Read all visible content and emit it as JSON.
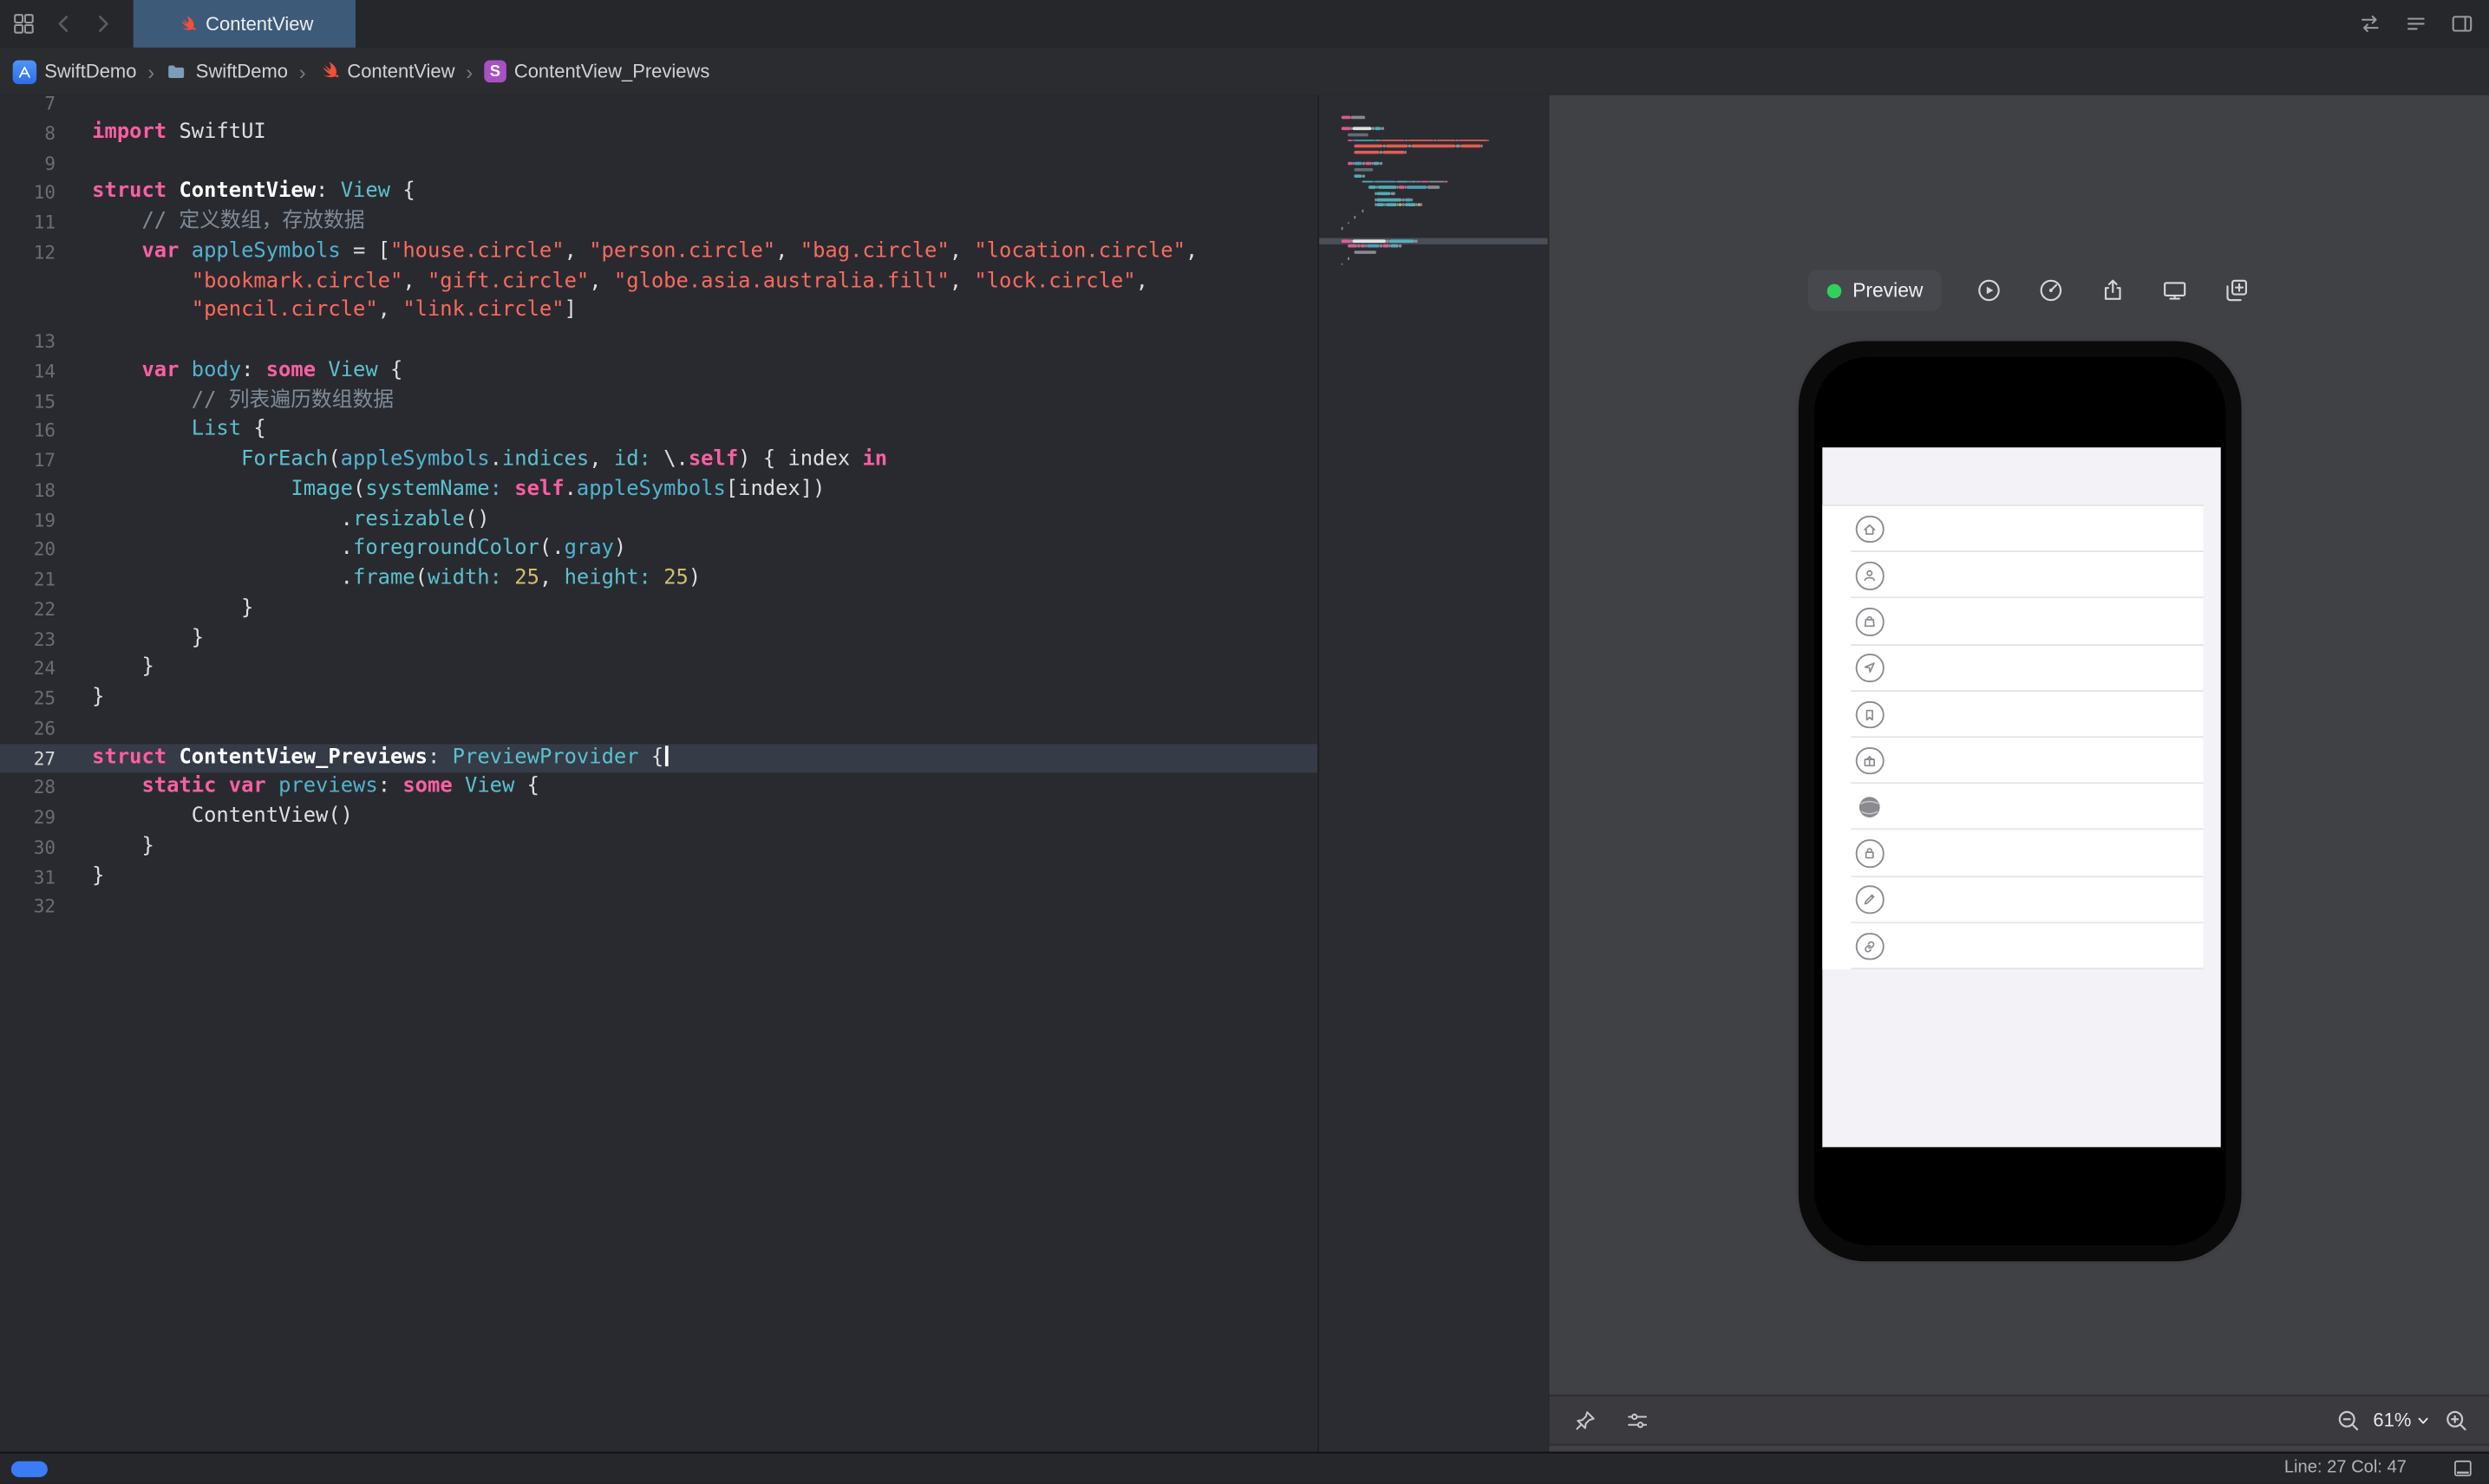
{
  "tabbar": {
    "tab_title": "ContentView",
    "left_icons": [
      "grid-icon",
      "chevron-back-icon",
      "chevron-forward-icon"
    ],
    "right_icons": [
      "code-review-icon",
      "editor-options-icon",
      "inspector-panel-icon"
    ]
  },
  "breadcrumb": {
    "separator": "›",
    "items": [
      {
        "icon": "app-badge-icon",
        "label": "SwiftDemo"
      },
      {
        "icon": "folder-icon",
        "label": "SwiftDemo"
      },
      {
        "icon": "swift-file-icon",
        "label": "ContentView"
      },
      {
        "icon": "struct-badge-icon",
        "label": "ContentView_Previews"
      }
    ]
  },
  "editor": {
    "rows": [
      {
        "n": "7"
      },
      {
        "n": "8",
        "t": [
          [
            "kw",
            "import"
          ],
          [
            "pl",
            " SwiftUI"
          ]
        ]
      },
      {
        "n": "9"
      },
      {
        "n": "10",
        "t": [
          [
            "kw",
            "struct"
          ],
          [
            "pl",
            " "
          ],
          [
            "de",
            "ContentView"
          ],
          [
            "pl",
            ": "
          ],
          [
            "ty",
            "View"
          ],
          [
            "pl",
            " {"
          ]
        ]
      },
      {
        "n": "11",
        "i": 4,
        "t": [
          [
            "cm",
            "// 定义数组，存放数据"
          ]
        ]
      },
      {
        "n": "12",
        "i": 4,
        "t": [
          [
            "kw",
            "var"
          ],
          [
            "pl",
            " "
          ],
          [
            "bl",
            "appleSymbols"
          ],
          [
            "pl",
            " = ["
          ],
          [
            "st",
            "\"house.circle\""
          ],
          [
            "pl",
            ", "
          ],
          [
            "st",
            "\"person.circle\""
          ],
          [
            "pl",
            ", "
          ],
          [
            "st",
            "\"bag.circle\""
          ],
          [
            "pl",
            ", "
          ],
          [
            "st",
            "\"location.circle\""
          ],
          [
            "pl",
            ","
          ]
        ]
      },
      {
        "i": 8,
        "t": [
          [
            "st",
            "\"bookmark.circle\""
          ],
          [
            "pl",
            ", "
          ],
          [
            "st",
            "\"gift.circle\""
          ],
          [
            "pl",
            ", "
          ],
          [
            "st",
            "\"globe.asia.australia.fill\""
          ],
          [
            "pl",
            ", "
          ],
          [
            "st",
            "\"lock.circle\""
          ],
          [
            "pl",
            ","
          ]
        ]
      },
      {
        "i": 8,
        "t": [
          [
            "st",
            "\"pencil.circle\""
          ],
          [
            "pl",
            ", "
          ],
          [
            "st",
            "\"link.circle\""
          ],
          [
            "pl",
            "]"
          ]
        ]
      },
      {
        "n": "13"
      },
      {
        "n": "14",
        "i": 4,
        "t": [
          [
            "kw",
            "var"
          ],
          [
            "pl",
            " "
          ],
          [
            "bl",
            "body"
          ],
          [
            "pl",
            ": "
          ],
          [
            "kw",
            "some"
          ],
          [
            "pl",
            " "
          ],
          [
            "ty",
            "View"
          ],
          [
            "pl",
            " {"
          ]
        ]
      },
      {
        "n": "15",
        "i": 8,
        "t": [
          [
            "cm",
            "// 列表遍历数组数据"
          ]
        ]
      },
      {
        "n": "16",
        "i": 8,
        "t": [
          [
            "ty",
            "List"
          ],
          [
            "pl",
            " {"
          ]
        ]
      },
      {
        "n": "17",
        "i": 12,
        "t": [
          [
            "ty",
            "ForEach"
          ],
          [
            "pl",
            "("
          ],
          [
            "bl",
            "appleSymbols"
          ],
          [
            "pl",
            "."
          ],
          [
            "ty",
            "indices"
          ],
          [
            "pl",
            ", "
          ],
          [
            "ty",
            "id:"
          ],
          [
            "pl",
            " \\."
          ],
          [
            "kw",
            "self"
          ],
          [
            "pl",
            ") { index "
          ],
          [
            "kw",
            "in"
          ]
        ]
      },
      {
        "n": "18",
        "i": 16,
        "t": [
          [
            "ty",
            "Image"
          ],
          [
            "pl",
            "("
          ],
          [
            "ty",
            "systemName:"
          ],
          [
            "pl",
            " "
          ],
          [
            "kw",
            "self"
          ],
          [
            "pl",
            "."
          ],
          [
            "bl",
            "appleSymbols"
          ],
          [
            "pl",
            "[index])"
          ]
        ]
      },
      {
        "n": "19",
        "i": 20,
        "t": [
          [
            "pl",
            "."
          ],
          [
            "ty",
            "resizable"
          ],
          [
            "pl",
            "()"
          ]
        ]
      },
      {
        "n": "20",
        "i": 20,
        "t": [
          [
            "pl",
            "."
          ],
          [
            "ty",
            "foregroundColor"
          ],
          [
            "pl",
            "(."
          ],
          [
            "bl",
            "gray"
          ],
          [
            "pl",
            ")"
          ]
        ]
      },
      {
        "n": "21",
        "i": 20,
        "t": [
          [
            "pl",
            "."
          ],
          [
            "ty",
            "frame"
          ],
          [
            "pl",
            "("
          ],
          [
            "ty",
            "width:"
          ],
          [
            "pl",
            " "
          ],
          [
            "nu",
            "25"
          ],
          [
            "pl",
            ", "
          ],
          [
            "ty",
            "height:"
          ],
          [
            "pl",
            " "
          ],
          [
            "nu",
            "25"
          ],
          [
            "pl",
            ")"
          ]
        ]
      },
      {
        "n": "22",
        "i": 12,
        "t": [
          [
            "pl",
            "}"
          ]
        ]
      },
      {
        "n": "23",
        "i": 8,
        "t": [
          [
            "pl",
            "}"
          ]
        ]
      },
      {
        "n": "24",
        "i": 4,
        "t": [
          [
            "pl",
            "}"
          ]
        ]
      },
      {
        "n": "25",
        "t": [
          [
            "pl",
            "}"
          ]
        ]
      },
      {
        "n": "26"
      },
      {
        "n": "27",
        "hl": true,
        "caret": true,
        "t": [
          [
            "kw",
            "struct"
          ],
          [
            "pl",
            " "
          ],
          [
            "de",
            "ContentView_Previews"
          ],
          [
            "pl",
            ": "
          ],
          [
            "ty",
            "PreviewProvider"
          ],
          [
            "pl",
            " {"
          ]
        ]
      },
      {
        "n": "28",
        "i": 4,
        "t": [
          [
            "kw",
            "static"
          ],
          [
            "pl",
            " "
          ],
          [
            "kw",
            "var"
          ],
          [
            "pl",
            " "
          ],
          [
            "bl",
            "previews"
          ],
          [
            "pl",
            ": "
          ],
          [
            "kw",
            "some"
          ],
          [
            "pl",
            " "
          ],
          [
            "ty",
            "View"
          ],
          [
            "pl",
            " {"
          ]
        ]
      },
      {
        "n": "29",
        "i": 8,
        "t": [
          [
            "pl",
            "ContentView()"
          ]
        ]
      },
      {
        "n": "30",
        "i": 4,
        "t": [
          [
            "pl",
            "}"
          ]
        ]
      },
      {
        "n": "31",
        "t": [
          [
            "pl",
            "}"
          ]
        ]
      },
      {
        "n": "32"
      }
    ]
  },
  "preview": {
    "toolbar": {
      "status_label": "Preview",
      "icons": [
        "live-preview-button-icon",
        "preview-variants-button-icon",
        "export-preview-button-icon",
        "preview-on-device-button-icon",
        "duplicate-preview-button-icon"
      ]
    },
    "symbols": [
      "house.circle",
      "person.circle",
      "bag.circle",
      "location.circle",
      "bookmark.circle",
      "gift.circle",
      "globe.asia.australia.fill",
      "lock.circle",
      "pencil.circle",
      "link.circle"
    ],
    "zoom": "61%",
    "bottom_icons": [
      "pin-preview-icon",
      "preview-layout-icon"
    ]
  },
  "statusbar": {
    "line_col": "Line: 27  Col: 47"
  },
  "colors": {
    "keyword": "#fc5fa3",
    "string": "#fc6a5d",
    "number": "#d0bf69",
    "comment": "#7f8c98",
    "plain_text": "#dfdfe0",
    "declaration": "#ffffff",
    "type": "#5bc1ce",
    "property": "#4fb4cf",
    "accent_blue": "#3a7bf6",
    "status_green": "#30d158",
    "swift_orange": "#f05138",
    "editor_bg": "#292a30",
    "canvas_bg": "#404144",
    "selected_tab_bg": "#3d5a78"
  }
}
